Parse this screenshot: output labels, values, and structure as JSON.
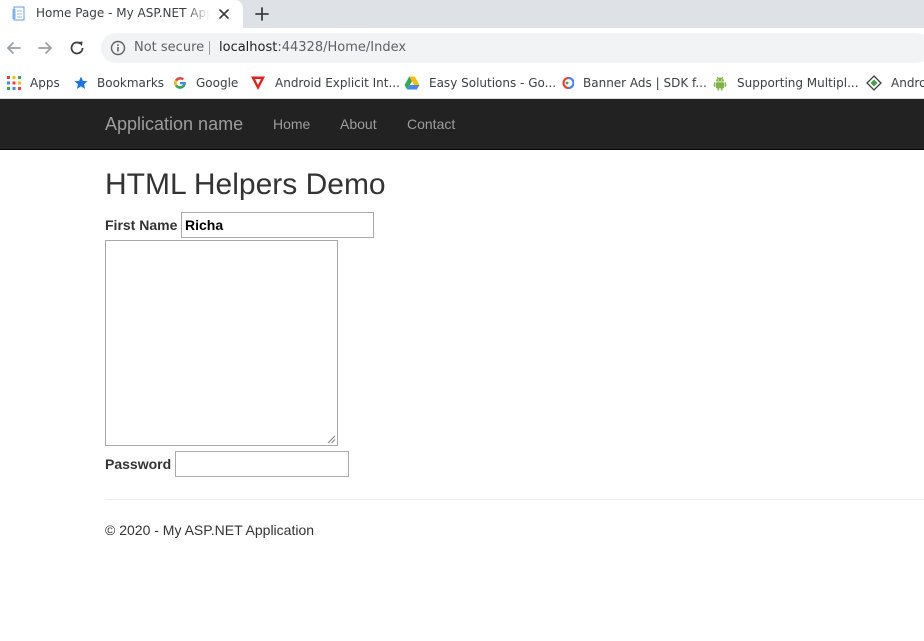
{
  "browser": {
    "tab": {
      "title": "Home Page - My ASP.NET Application"
    },
    "address": {
      "security_label": "Not secure",
      "host": "localhost",
      "port_path": ":44328/Home/Index"
    },
    "bookmarks": [
      {
        "label": "Apps",
        "icon": "apps-grid-icon"
      },
      {
        "label": "Bookmarks",
        "icon": "star-icon"
      },
      {
        "label": "Google",
        "icon": "google-icon"
      },
      {
        "label": "Android Explicit Int...",
        "icon": "red-triangle-icon"
      },
      {
        "label": "Easy Solutions - Go...",
        "icon": "google-drive-icon"
      },
      {
        "label": "Banner Ads  |  SDK f...",
        "icon": "admob-icon"
      },
      {
        "label": "Supporting Multipl...",
        "icon": "android-icon"
      },
      {
        "label": "Andro",
        "icon": "diamond-icon"
      }
    ]
  },
  "site": {
    "brand": "Application name",
    "nav": [
      "Home",
      "About",
      "Contact"
    ],
    "heading": "HTML Helpers Demo",
    "form": {
      "first_name_label": "First Name",
      "first_name_value": "Richa",
      "password_label": "Password",
      "password_value": ""
    },
    "footer": "© 2020 - My ASP.NET Application"
  },
  "colors": {
    "navbar_bg": "#222222",
    "navbar_text": "#9d9d9d",
    "tabstrip_bg": "#dee1e6",
    "omnibox_bg": "#f1f3f4"
  }
}
